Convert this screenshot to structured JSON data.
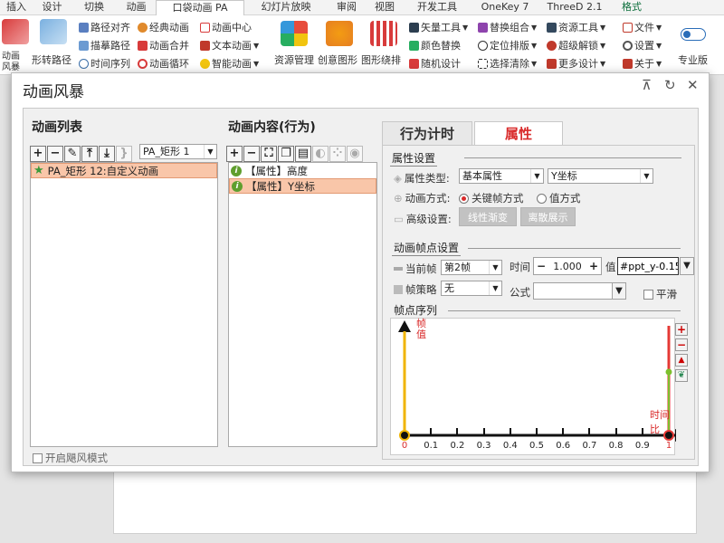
{
  "ribbon": {
    "tabs": [
      "插入",
      "设计",
      "切换",
      "动画",
      "口袋动画 PA",
      "幻灯片放映",
      "审阅",
      "视图",
      "开发工具",
      "OneKey 7",
      "ThreeD 2.1",
      "格式"
    ],
    "items": {
      "big_anim_storm": "动画风暴",
      "big_shape_path": "形转路径",
      "path_align": "路径对齐",
      "draw_path": "描摹路径",
      "timeline": "时间序列",
      "classic_anim": "经典动画",
      "anim_merge": "动画合并",
      "anim_loop": "动画循环",
      "anim_center": "动画中心",
      "text_anim": "文本动画",
      "smart_anim": "智能动画",
      "resource_mgr": "资源管理",
      "creative_shape": "创意图形",
      "shape_arrange": "图形绕排",
      "vector_tool": "矢量工具",
      "color_replace": "颜色替换",
      "random_design": "随机设计",
      "replace_combo": "替换组合",
      "position_layout": "定位排版",
      "select_clear": "选择清除",
      "resource_tool": "资源工具",
      "super_unlock": "超级解锁",
      "more_design": "更多设计",
      "file": "文件",
      "settings": "设置",
      "about": "关于",
      "pro_version": "专业版"
    }
  },
  "dialog": {
    "title": "动画风暴",
    "anim_list": {
      "title": "动画列表",
      "dropdown_value": "PA_矩形 1",
      "items": [
        {
          "label": "PA_矩形 12:自定义动画",
          "selected": true
        }
      ]
    },
    "anim_content": {
      "title": "动画内容(行为)",
      "items": [
        {
          "label": "【属性】高度",
          "selected": false
        },
        {
          "label": "【属性】Y坐标",
          "selected": true
        }
      ]
    },
    "storm_mode_label": "开启飓风模式",
    "tabs": [
      {
        "label": "行为计时",
        "active": false
      },
      {
        "label": "属性",
        "active": true
      }
    ],
    "props": {
      "group_title": "属性设置",
      "type_label": "属性类型:",
      "type_value": "基本属性",
      "type_value2": "Y坐标",
      "method_label": "动画方式:",
      "method_keyframe": "关键帧方式",
      "method_value": "值方式",
      "advanced_label": "高级设置:",
      "linear_gradient_btn": "线性渐变",
      "discrete_btn": "离散展示"
    },
    "keyframe": {
      "group_title": "动画帧点设置",
      "current_frame_label": "当前帧",
      "current_frame_value": "第2帧",
      "time_label": "时间",
      "time_value": "1.000",
      "value_label": "值",
      "value_text": "#ppt_y-0.15",
      "strategy_label": "帧策略",
      "strategy_value": "无",
      "formula_label": "公式",
      "formula_value": "",
      "smooth_label": "平滑"
    },
    "sequence": {
      "group_title": "帧点序列",
      "y_axis_label": "帧值",
      "x_axis_label": "时间比",
      "ticks": [
        "0",
        "0.1",
        "0.2",
        "0.3",
        "0.4",
        "0.5",
        "0.6",
        "0.7",
        "0.8",
        "0.9",
        "1"
      ],
      "frame_points": [
        0,
        1
      ]
    }
  },
  "colors": {
    "accent_red": "#d92b2b",
    "selection": "#f9c6a9",
    "tab_active_text": "#d92b2b",
    "frame_yellow": "#f0b400",
    "frame_green": "#7dbf2e"
  }
}
